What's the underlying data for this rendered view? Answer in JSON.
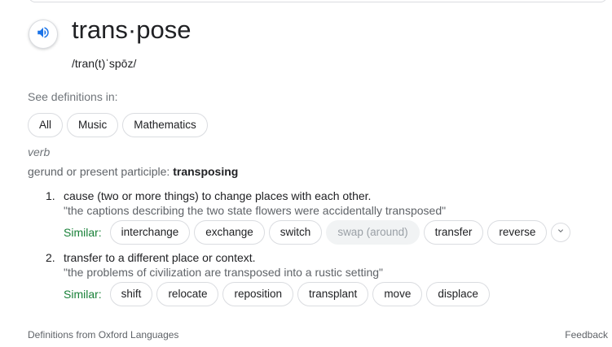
{
  "entry": {
    "headword": "trans·pose",
    "pronunciation": "/tran(t)ˈspōz/"
  },
  "see_definitions": {
    "label": "See definitions in:",
    "categories": [
      "All",
      "Music",
      "Mathematics"
    ]
  },
  "part_of_speech": "verb",
  "inflection": {
    "label": "gerund or present participle:",
    "form": "transposing"
  },
  "senses": [
    {
      "number": "1.",
      "definition": "cause (two or more things) to change places with each other.",
      "example": "\"the captions describing the two state flowers were accidentally transposed\"",
      "similar_label": "Similar:",
      "similar": [
        "interchange",
        "exchange",
        "switch",
        "swap (around)",
        "transfer",
        "reverse"
      ]
    },
    {
      "number": "2.",
      "definition": "transfer to a different place or context.",
      "example": "\"the problems of civilization are transposed into a rustic setting\"",
      "similar_label": "Similar:",
      "similar": [
        "shift",
        "relocate",
        "reposition",
        "transplant",
        "move",
        "displace"
      ]
    }
  ],
  "footer": {
    "source": "Definitions from Oxford Languages",
    "feedback": "Feedback"
  },
  "colors": {
    "accent": "#1a73e8",
    "similar_green": "#188038",
    "chip_border": "#dadce0"
  }
}
